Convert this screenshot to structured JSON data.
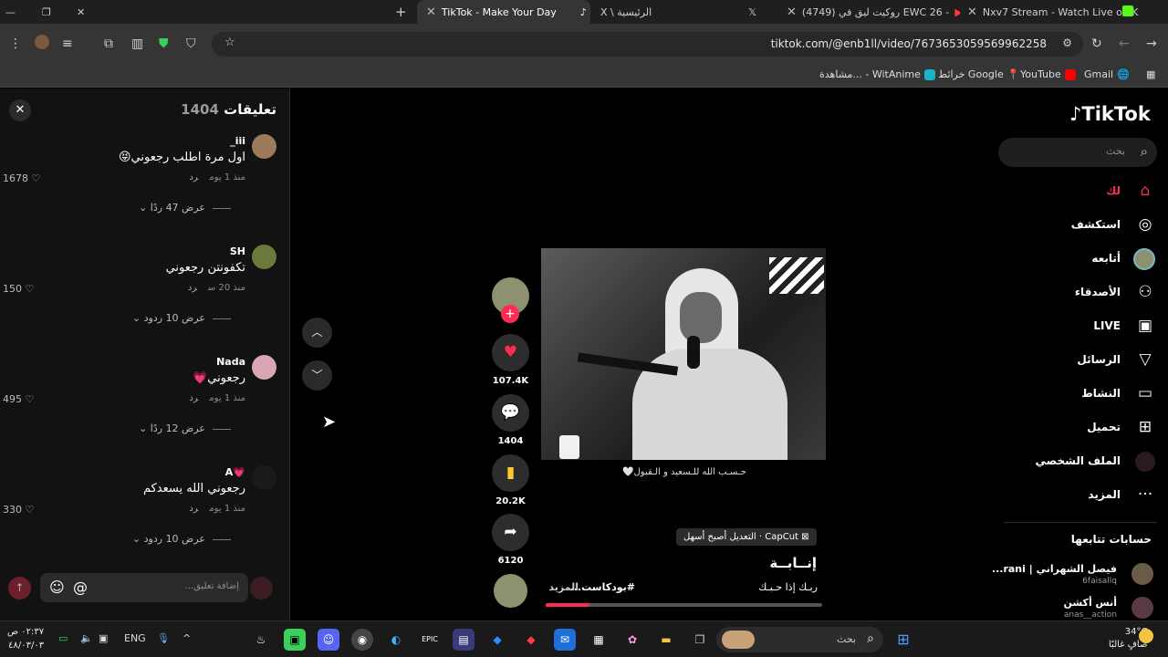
{
  "browser": {
    "tabs": [
      {
        "label": "Nxv7 Stream - Watch Live on K"
      },
      {
        "label": "(4749) روكيت ليق في EWC 26 -"
      },
      {
        "label": "X \\ الرئيسية"
      },
      {
        "label": "TikTok - Make Your Day"
      }
    ],
    "new_tab": "+",
    "url": "tiktok.com/@enb1ll/video/7673653059569962258",
    "bookmarks": [
      {
        "label": "Gmail"
      },
      {
        "label": "YouTube"
      },
      {
        "label": "خرائط Google"
      },
      {
        "label": "مشاهدة... - WitAnime"
      }
    ]
  },
  "comments_panel": {
    "title": "تعليقات",
    "count": "1404",
    "close": "✕",
    "comments": [
      {
        "user": "_iii",
        "text": "اول مرة اطلب رجعوني😝",
        "time": "منذ 1 يوم",
        "reply": "رد",
        "likes": "1678",
        "views": "عرض 47 ردًا"
      },
      {
        "user": "SH",
        "text": "تكفونتن رجعوني",
        "time": "منذ 20 س",
        "reply": "رد",
        "likes": "150",
        "views": "عرض 10 ردود"
      },
      {
        "user": "Nada",
        "text": "رجعوني💗",
        "time": "منذ 1 يوم",
        "reply": "رد",
        "likes": "495",
        "views": "عرض 12 ردًا"
      },
      {
        "user": "A💗",
        "text": "رجعوني الله يسعدكم",
        "time": "منذ 1 يوم",
        "reply": "رد",
        "likes": "330",
        "views": "عرض 10 ردود"
      }
    ],
    "input_placeholder": "إضافة تعليق..."
  },
  "video": {
    "caption_overlay": "حـسـب الله للـسعيد و الـقبول🤍",
    "capcut_label": "CapCut · التعديل أصبح أسهل",
    "title": "إنــابــة",
    "desc": "ربـك إذا حـبـك",
    "hashtag": "#بودكاست...",
    "more": "المزيد",
    "progress": 0.16,
    "actions": [
      {
        "icon": "heart-icon",
        "count": "107.4K"
      },
      {
        "icon": "comment-icon",
        "count": "1404"
      },
      {
        "icon": "bookmark-icon",
        "count": "20.2K"
      },
      {
        "icon": "share-icon",
        "count": "6120"
      }
    ]
  },
  "sidebar": {
    "logo": "TikTok",
    "search_placeholder": "بحث",
    "items": [
      {
        "label": "لك",
        "icon": "⌂"
      },
      {
        "label": "استكشف",
        "icon": "◎"
      },
      {
        "label": "أتابعه",
        "icon": "●"
      },
      {
        "label": "الأصدقاء",
        "icon": "⚇"
      },
      {
        "label": "LIVE",
        "icon": "▣"
      },
      {
        "label": "الرسائل",
        "icon": "▽"
      },
      {
        "label": "النشاط",
        "icon": "▭"
      },
      {
        "label": "تحميل",
        "icon": "⊞"
      },
      {
        "label": "الملف الشخصي",
        "icon": "●"
      },
      {
        "label": "المزيد",
        "icon": "···"
      }
    ],
    "following_title": "حسابات تتابعها",
    "following": [
      {
        "name": "فيصل الشهراني | rani...",
        "handle": "6faisallq"
      },
      {
        "name": "أنس أكشن",
        "handle": "anas__action"
      }
    ]
  },
  "taskbar": {
    "search": "بحث",
    "lang": "ENG",
    "time": "٠٢:٣٧ ص",
    "date": "٤٨/٠٣/٠٣",
    "temp": "34°C",
    "weather": "صافٍ غالبًا"
  }
}
